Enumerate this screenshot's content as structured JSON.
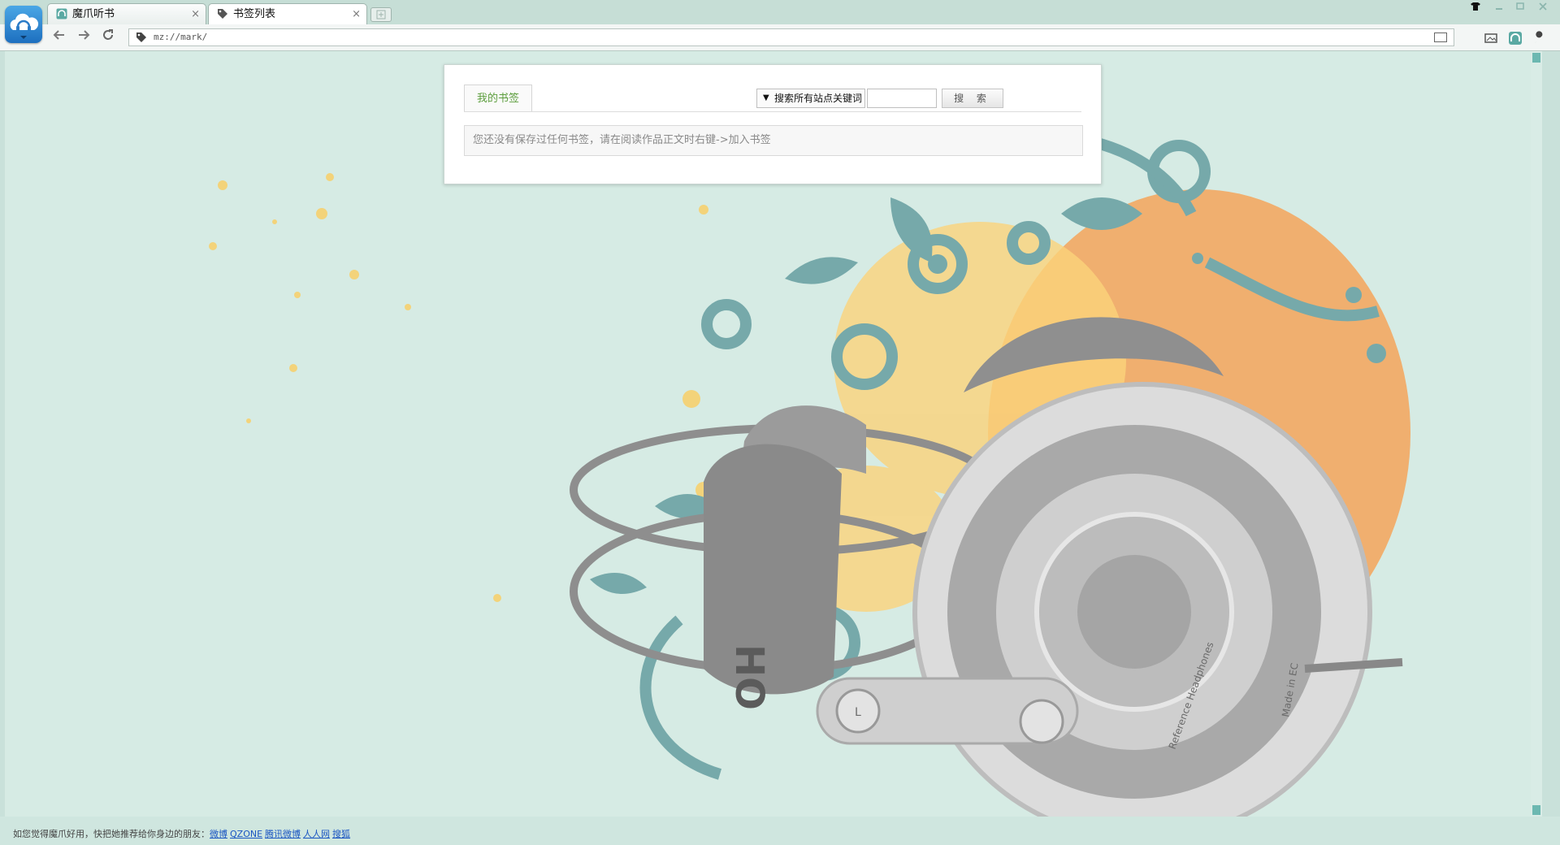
{
  "tabs": [
    {
      "title": "魔爪听书",
      "close": "×"
    },
    {
      "title": "书签列表",
      "close": "×"
    }
  ],
  "toolbar": {
    "address": "mz://mark/"
  },
  "bookmarks": {
    "tab_label": "我的书签",
    "search_scope": "搜索所有站点关键词",
    "search_value": "",
    "search_button": "搜 索",
    "empty_message": "您还没有保存过任何书签，请在阅读作品正文时右键->加入书签"
  },
  "footer": {
    "prompt": "如您觉得魔爪好用，快把她推荐给你身边的朋友：",
    "links": [
      "微博",
      "QZONE",
      "腾讯微博",
      "人人网",
      "搜狐"
    ]
  },
  "decor": {
    "headphone_text": [
      "Reference Headphones",
      "Made in EC",
      "HO",
      "L"
    ]
  },
  "colors": {
    "page_bg": "#d6ebe4",
    "accent_green": "#5b9d3c",
    "link_blue": "#1a55c2",
    "teal": "#6ea7a8",
    "yellow": "#f7d36a",
    "orange": "#f2a25a"
  }
}
